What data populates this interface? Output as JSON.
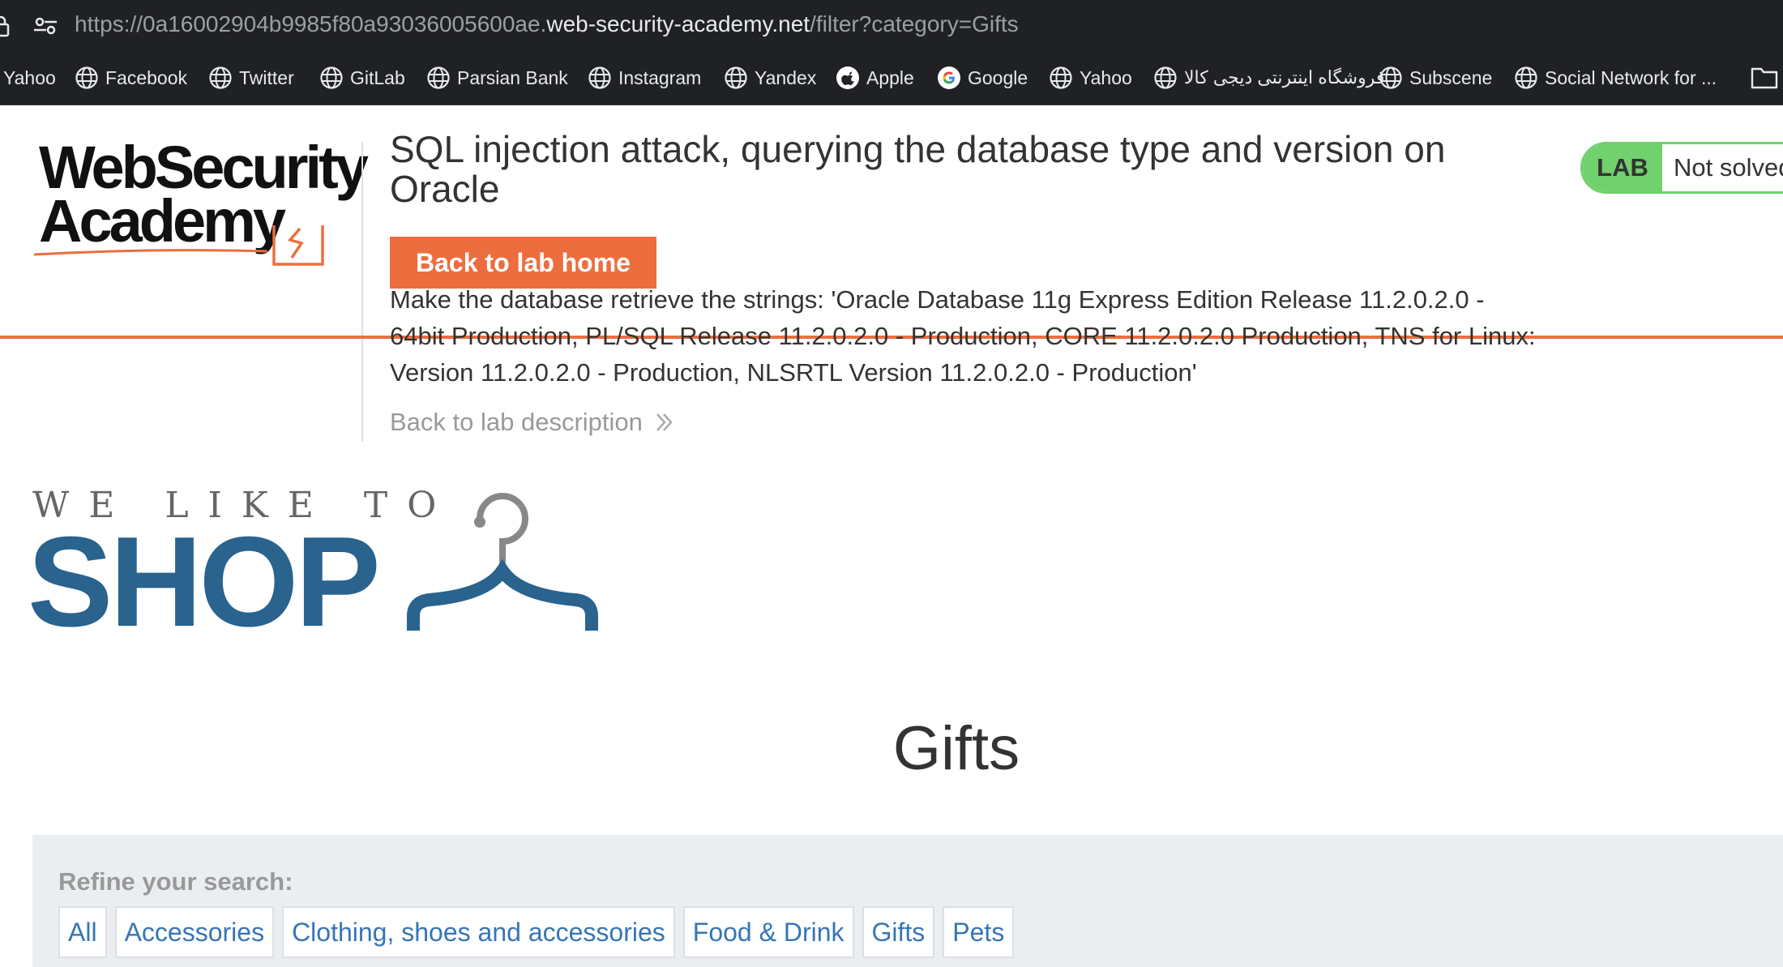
{
  "browser": {
    "url_prefix": "https://0a16002904b9985f80a93036005600ae.",
    "url_host": "web-security-academy.net",
    "url_path": "/filter?category=Gifts",
    "bookmarks": [
      {
        "label": "Yahoo",
        "icon": "none"
      },
      {
        "label": "Facebook",
        "icon": "globe-icon"
      },
      {
        "label": "Twitter",
        "icon": "globe-icon"
      },
      {
        "label": "GitLab",
        "icon": "globe-icon"
      },
      {
        "label": "Parsian Bank",
        "icon": "globe-icon"
      },
      {
        "label": "Instagram",
        "icon": "globe-icon"
      },
      {
        "label": "Yandex",
        "icon": "globe-icon"
      },
      {
        "label": "Apple",
        "icon": "apple-icon"
      },
      {
        "label": "Google",
        "icon": "google-icon"
      },
      {
        "label": "Yahoo",
        "icon": "globe-icon"
      },
      {
        "label": "فروشگاه اینترنتی دیجی کالا",
        "icon": "globe-icon"
      },
      {
        "label": "Subscene",
        "icon": "globe-icon"
      },
      {
        "label": "Social Network for ...",
        "icon": "globe-icon"
      }
    ]
  },
  "logo": {
    "line1": "WebSecurity",
    "line2": "Academy"
  },
  "lab": {
    "title": "SQL injection attack, querying the database type and version on Oracle",
    "back_home": "Back to lab home",
    "description": "Make the database retrieve the strings: 'Oracle Database 11g Express Edition Release 11.2.0.2.0 - 64bit Production, PL/SQL Release 11.2.0.2.0 - Production, CORE 11.2.0.2.0 Production, TNS for Linux: Version 11.2.0.2.0 - Production, NLSRTL Version 11.2.0.2.0 - Production'",
    "back_description": "Back to lab description",
    "badge_tag": "LAB",
    "badge_status": "Not solved"
  },
  "shop": {
    "tagline": "WE LIKE TO",
    "name": "SHOP"
  },
  "page": {
    "heading": "Gifts"
  },
  "filter": {
    "refine_label": "Refine your search:",
    "categories": [
      "All",
      "Accessories",
      "Clothing, shoes and accessories",
      "Food & Drink",
      "Gifts",
      "Pets"
    ]
  },
  "colors": {
    "accent": "#ec6e3e",
    "shop_blue": "#29638e",
    "lab_green": "#70d16d",
    "link": "#3576b6"
  }
}
